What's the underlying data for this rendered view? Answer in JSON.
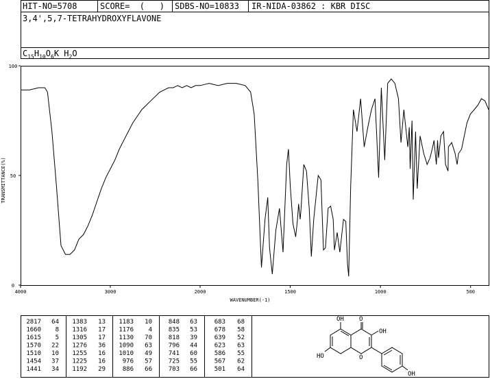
{
  "header": {
    "hit_no": "HIT-NO=5708",
    "score": "SCORE=  (   )",
    "sdbs_no": "SDBS-NO=10833",
    "ir_nida": "IR-NIDA-03862 : KBR DISC",
    "compound_name": "3,4',5,7-TETRAHYDROXYFLAVONE",
    "formula": "C15H10O6K H2O"
  },
  "chart_data": {
    "type": "line",
    "xlabel": "WAVENUMBER(-1)",
    "ylabel": "TRANSMITTANCE(%)",
    "xlim": [
      4000,
      400
    ],
    "ylim": [
      0,
      100
    ],
    "x_ticks": [
      "4000",
      "3000",
      "2000",
      "1500",
      "1000",
      "500"
    ],
    "y_ticks": [
      "100",
      "50",
      "0"
    ],
    "series": [
      {
        "x": [
          4000,
          3900,
          3800,
          3730,
          3700,
          3650,
          3600,
          3550,
          3500,
          3450,
          3400,
          3350,
          3300,
          3250,
          3200,
          3150,
          3100,
          3050,
          3000,
          2950,
          2900,
          2850,
          2800,
          2750,
          2700,
          2650,
          2600,
          2550,
          2500,
          2450,
          2400,
          2350,
          2300,
          2250,
          2200,
          2150,
          2100,
          2050,
          2000,
          1950,
          1900,
          1850,
          1800,
          1750,
          1720,
          1700,
          1680,
          1660,
          1640,
          1625,
          1615,
          1600,
          1580,
          1560,
          1540,
          1520,
          1510,
          1500,
          1485,
          1470,
          1460,
          1454,
          1445,
          1441,
          1425,
          1410,
          1395,
          1383,
          1370,
          1345,
          1330,
          1316,
          1305,
          1290,
          1276,
          1262,
          1255,
          1240,
          1225,
          1205,
          1192,
          1183,
          1176,
          1165,
          1150,
          1130,
          1110,
          1090,
          1070,
          1050,
          1030,
          1010,
          995,
          976,
          960,
          940,
          920,
          900,
          886,
          870,
          848,
          840,
          835,
          825,
          818,
          805,
          796,
          780,
          760,
          741,
          725,
          710,
          703,
          690,
          683,
          678,
          665,
          650,
          639,
          625,
          623,
          605,
          586,
          575,
          567,
          550,
          520,
          501,
          480,
          460,
          440,
          420,
          400
        ],
        "y": [
          89,
          89,
          90,
          90,
          88,
          70,
          45,
          18,
          14,
          14,
          16,
          21,
          23,
          27,
          32,
          38,
          44,
          49,
          53,
          57,
          62,
          66,
          70,
          74,
          77,
          80,
          82,
          84,
          86,
          88,
          89,
          90,
          90,
          91,
          90,
          91,
          90,
          91,
          91,
          92,
          91,
          92,
          92,
          91,
          88,
          78,
          48,
          8,
          30,
          40,
          17,
          5,
          25,
          35,
          15,
          55,
          62,
          45,
          28,
          22,
          30,
          37,
          30,
          34,
          55,
          52,
          35,
          13,
          30,
          50,
          48,
          16,
          17,
          35,
          36,
          30,
          16,
          24,
          15,
          30,
          29,
          10,
          4,
          45,
          80,
          70,
          85,
          63,
          72,
          80,
          85,
          49,
          90,
          57,
          92,
          94,
          92,
          85,
          65,
          80,
          63,
          72,
          53,
          75,
          39,
          70,
          44,
          68,
          60,
          55,
          58,
          63,
          66,
          55,
          66,
          58,
          68,
          70,
          55,
          52,
          63,
          65,
          60,
          55,
          60,
          62,
          74,
          78,
          80,
          82,
          85,
          84,
          80
        ]
      }
    ]
  },
  "peak_table": {
    "columns": [
      [
        [
          "2817",
          "64"
        ],
        [
          "1660",
          "8"
        ],
        [
          "1615",
          "5"
        ],
        [
          "1570",
          "22"
        ],
        [
          "1510",
          "10"
        ],
        [
          "1454",
          "37"
        ],
        [
          "1441",
          "34"
        ]
      ],
      [
        [
          "1383",
          "13"
        ],
        [
          "1316",
          "17"
        ],
        [
          "1305",
          "17"
        ],
        [
          "1276",
          "36"
        ],
        [
          "1255",
          "16"
        ],
        [
          "1225",
          "16"
        ],
        [
          "1192",
          "29"
        ]
      ],
      [
        [
          "1183",
          "10"
        ],
        [
          "1176",
          "4"
        ],
        [
          "1130",
          "70"
        ],
        [
          "1090",
          "63"
        ],
        [
          "1010",
          "49"
        ],
        [
          "976",
          "57"
        ],
        [
          "886",
          "66"
        ]
      ],
      [
        [
          "848",
          "63"
        ],
        [
          "835",
          "53"
        ],
        [
          "818",
          "39"
        ],
        [
          "796",
          "44"
        ],
        [
          "741",
          "60"
        ],
        [
          "725",
          "55"
        ],
        [
          "703",
          "66"
        ]
      ],
      [
        [
          "683",
          "68"
        ],
        [
          "678",
          "58"
        ],
        [
          "639",
          "52"
        ],
        [
          "623",
          "63"
        ],
        [
          "586",
          "55"
        ],
        [
          "567",
          "62"
        ],
        [
          "501",
          "64"
        ]
      ]
    ]
  },
  "structure": {
    "labels": [
      "OH",
      "O",
      "OH",
      "HO",
      "O",
      "OH"
    ]
  }
}
